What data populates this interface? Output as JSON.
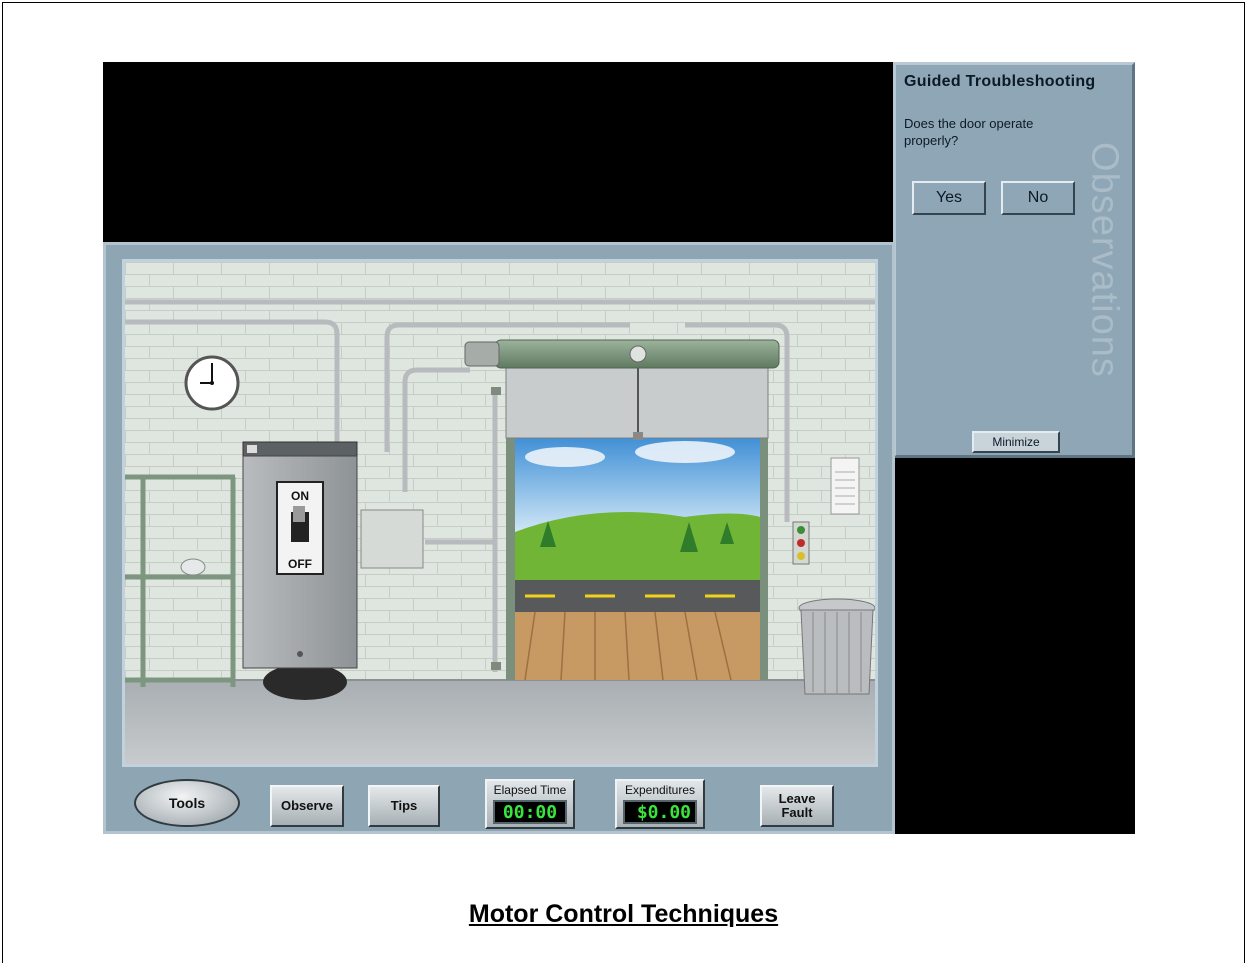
{
  "guided_panel": {
    "title": "Guided Troubleshooting",
    "question": "Does the door operate properly?",
    "yes_label": "Yes",
    "no_label": "No",
    "watermark": "Observations",
    "minimize_label": "Minimize"
  },
  "scene": {
    "disconnect_switch": {
      "on_label": "ON",
      "off_label": "OFF"
    }
  },
  "toolbar": {
    "tools_label": "Tools",
    "observe_label": "Observe",
    "tips_label": "Tips",
    "elapsed_time_label": "Elapsed Time",
    "elapsed_time_value": "00:00",
    "expenditures_label": "Expenditures",
    "expenditures_value": "$0.00",
    "leave_fault_label": "Leave Fault"
  },
  "caption": "Motor Control Techniques",
  "colors": {
    "panel": "#8fa6b6",
    "meter_digits": "#39e53c",
    "background": "#000000"
  }
}
